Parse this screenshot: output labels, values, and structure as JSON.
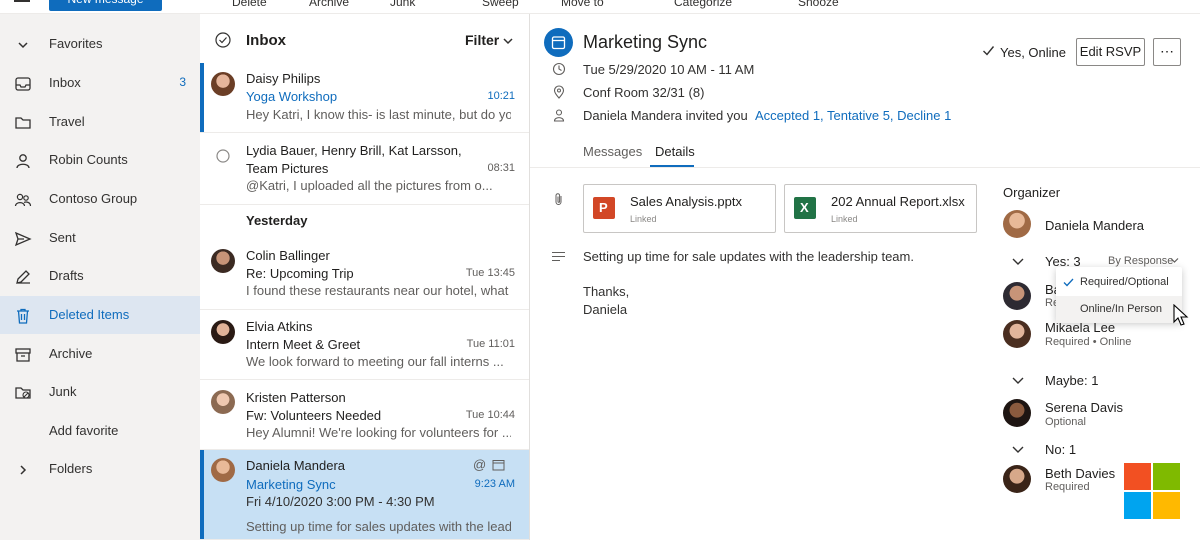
{
  "toolbar": {
    "new_message": "New message",
    "delete": "Delete",
    "archive": "Archive",
    "junk": "Junk",
    "sweep": "Sweep",
    "move_to": "Move to",
    "categorize": "Categorize",
    "snooze": "Snooze"
  },
  "nav": {
    "items": [
      {
        "label": "Favorites",
        "icon": "chevron-down-icon"
      },
      {
        "label": "Inbox",
        "count": "3",
        "icon": "inbox-icon"
      },
      {
        "label": "Travel",
        "icon": "folder-icon"
      },
      {
        "label": "Robin Counts",
        "icon": "person-icon"
      },
      {
        "label": "Contoso Group",
        "icon": "people-icon"
      },
      {
        "label": "Sent",
        "icon": "send-icon"
      },
      {
        "label": "Drafts",
        "icon": "pencil-icon"
      },
      {
        "label": "Deleted Items",
        "icon": "trash-icon"
      },
      {
        "label": "Archive",
        "icon": "archive-icon"
      },
      {
        "label": "Junk",
        "icon": "junk-icon"
      },
      {
        "label": "Add favorite"
      },
      {
        "label": "Folders",
        "icon": "chevron-right-icon"
      }
    ]
  },
  "list": {
    "title": "Inbox",
    "filter": "Filter",
    "section_yesterday": "Yesterday",
    "messages": [
      {
        "sender": "Daisy Philips",
        "subject": "Yoga Workshop",
        "time": "10:21",
        "preview": "Hey Katri, I know this- is last minute, but do you"
      },
      {
        "sender": "Lydia Bauer, Henry Brill, Kat Larsson,",
        "subject": "Team Pictures",
        "time": "08:31",
        "preview": "@Katri, I uploaded all the pictures from o..."
      },
      {
        "sender": "Colin Ballinger",
        "subject": "Re: Upcoming Trip",
        "time": "Tue 13:45",
        "preview": "I found these restaurants near our hotel, what ..."
      },
      {
        "sender": "Elvia Atkins",
        "subject": "Intern Meet & Greet",
        "time": "Tue 11:01",
        "preview": "We look forward to meeting our fall interns ..."
      },
      {
        "sender": "Kristen Patterson",
        "subject": "Fw: Volunteers Needed",
        "time": "Tue 10:44",
        "preview": "Hey Alumni! We're looking for volunteers for ..."
      },
      {
        "sender": "Daniela Mandera",
        "subject": "Marketing Sync",
        "time": "9:23 AM",
        "preview": "Fri 4/10/2020 3:00 PM - 4:30 PM",
        "preview2": "Setting up time for sales updates with the lead..."
      }
    ]
  },
  "event": {
    "title": "Marketing Sync",
    "rsvp_status": "Yes, Online",
    "edit_rsvp": "Edit RSVP",
    "more": "⋯",
    "datetime": "Tue 5/29/2020 10 AM - 11 AM",
    "location": "Conf Room 32/31 (8)",
    "invited": "Daniela Mandera invited you",
    "responses": "Accepted 1, Tentative 5, Decline 1",
    "tabs": [
      "Messages",
      "Details"
    ],
    "attachments": [
      {
        "name": "Sales Analysis.pptx",
        "sub": "Linked",
        "type": "powerpoint"
      },
      {
        "name": "202 Annual Report.xlsx",
        "sub": "Linked",
        "type": "excel"
      }
    ],
    "body_lines": [
      "Setting up time for sale updates with the leadership team.",
      "Thanks,",
      "Daniela"
    ]
  },
  "attendees": {
    "organizer_label": "Organizer",
    "organizer": "Daniela Mandera",
    "yes_header": "Yes: 3",
    "sort_label": "By Response",
    "dropdown": [
      "Required/Optional",
      "Online/In Person"
    ],
    "yes_people": [
      {
        "name": "Ba",
        "sub": "Re"
      },
      {
        "name": "Mikaela Lee",
        "sub": "Required • Online"
      }
    ],
    "maybe_header": "Maybe: 1",
    "maybe_people": [
      {
        "name": "Serena Davis",
        "sub": "Optional"
      }
    ],
    "no_header": "No: 1",
    "no_people": [
      {
        "name": "Beth Davies",
        "sub": "Required"
      }
    ]
  },
  "colors": {
    "accent": "#0f6cbd",
    "logo": [
      "#f25022",
      "#7fba00",
      "#00a4ef",
      "#ffb900"
    ]
  }
}
